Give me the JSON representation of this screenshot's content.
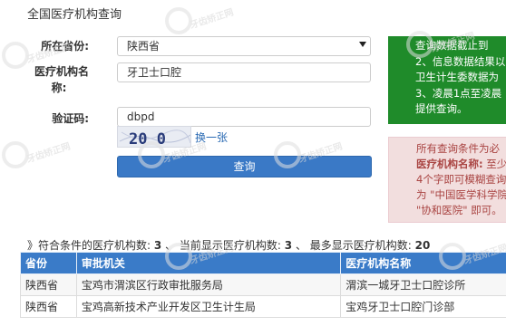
{
  "page": {
    "title": "全国医疗机构查询"
  },
  "form": {
    "province_label": "所在省份:",
    "province_value": "陕西省",
    "name_label_line1": "医疗机构名",
    "name_label_line2": "称:",
    "name_value": "牙卫士口腔",
    "captcha_label": "验证码:",
    "captcha_value": "dbpd",
    "captcha_image_text": "20 0",
    "refresh_link": "换一张",
    "query_button": "查询"
  },
  "notice_green": {
    "lines": [
      "查询数据截止到",
      "2、信息数据结果以",
      "卫生计生委数据为",
      "3、凌晨1点至凌晨",
      "提供查询。"
    ]
  },
  "notice_red": {
    "line1": "所有查询条件为必",
    "line2_strong": "医疗机构名称:",
    "line2_rest": " 至少",
    "line3": "4个字即可模糊查询",
    "line4": "为 \"中国医学科学院",
    "line5": "\"协和医院\" 即可。"
  },
  "summary": {
    "prefix": "》符合条件的医疗机构数:",
    "matched_count": "3",
    "sep1": "、 当前显示医疗机构数:",
    "shown_count": "3",
    "sep2": "、 最多显示医疗机构数:",
    "max_count": "20"
  },
  "table": {
    "headers": [
      "省份",
      "审批机关",
      "医疗机构名称"
    ],
    "rows": [
      [
        "陕西省",
        "宝鸡市渭滨区行政审批服务局",
        "渭滨一城牙卫士口腔诊所"
      ],
      [
        "陕西省",
        "宝鸡高新技术产业开发区卫生计生局",
        "宝鸡牙卫士口腔门诊部"
      ]
    ]
  },
  "watermark": {
    "text": "牙齿矫正网"
  },
  "colors": {
    "header_blue": "#3a7bc8",
    "button_blue": "#3a79c6",
    "notice_green": "#1f8b2a",
    "notice_red_bg": "#f2dede",
    "notice_red_text": "#a94442",
    "link_blue": "#2a6ab3"
  },
  "icons": {
    "select_caret": "chevron-down-icon",
    "watermark": "watermark-logo-icon"
  }
}
